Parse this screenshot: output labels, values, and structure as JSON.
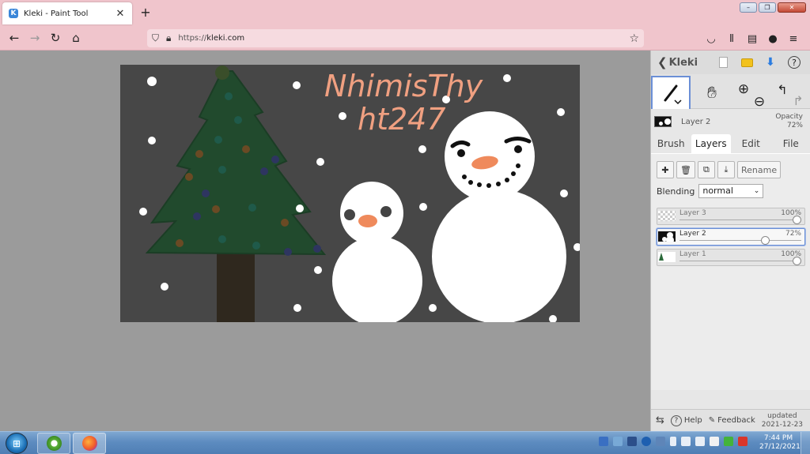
{
  "browser": {
    "tab_title": "Kleki - Paint Tool",
    "tab_favicon": "kleki-icon",
    "url_prefix": "https://",
    "url_host": "kleki.com"
  },
  "canvas": {
    "background_color": "#474747",
    "handwritten_text": [
      "NhimisThy",
      "ht247"
    ],
    "handwriting_color": "#f0a081"
  },
  "panel": {
    "app_name": "Kleki",
    "active_layer_name": "Layer 2",
    "opacity_label": "Opacity",
    "opacity_value": "72%",
    "tabs": [
      {
        "label": "Brush",
        "active": false
      },
      {
        "label": "Layers",
        "active": true
      },
      {
        "label": "Edit",
        "active": false
      },
      {
        "label": "File",
        "active": false
      }
    ],
    "layer_buttons": {
      "rename": "Rename"
    },
    "blending_label": "Blending",
    "blending_value": "normal",
    "layers": [
      {
        "name": "Layer 3",
        "opacity": "100%",
        "opacity_fraction": 1.0,
        "selected": false,
        "thumb": "checker"
      },
      {
        "name": "Layer 2",
        "opacity": "72%",
        "opacity_fraction": 0.72,
        "selected": true,
        "thumb": "black"
      },
      {
        "name": "Layer 1",
        "opacity": "100%",
        "opacity_fraction": 1.0,
        "selected": false,
        "thumb": "green"
      }
    ],
    "footer": {
      "help": "Help",
      "feedback": "Feedback",
      "updated_label": "updated",
      "updated_date": "2021-12-23"
    }
  },
  "taskbar": {
    "time": "7:44 PM",
    "date": "27/12/2021"
  },
  "colors": {
    "browser_chrome": "#f0c5cc",
    "accent": "#6b8fd6",
    "tree_green": "#214a2d",
    "trunk": "#2f281e",
    "carrot": "#ef8a5c"
  }
}
